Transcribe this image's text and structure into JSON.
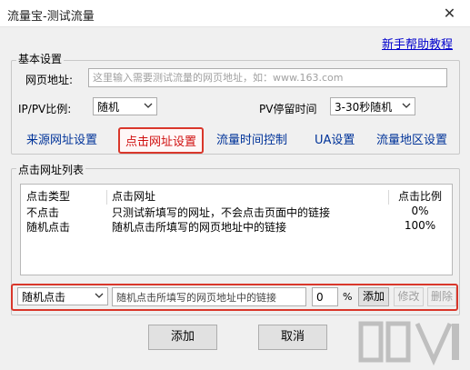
{
  "window": {
    "title": "流量宝-测试流量",
    "close_glyph": "✕"
  },
  "help_link": "新手帮助教程",
  "basic": {
    "group_label": "基本设置",
    "url_label": "网页地址:",
    "url_placeholder": "这里输入需要测试流量的网页地址，如：www.163.com",
    "ippv_label": "IP/PV比例:",
    "ippv_value": "随机",
    "stay_label": "PV停留时间",
    "stay_value": "3-30秒随机",
    "tabs": [
      "来源网址设置",
      "点击网址设置",
      "流量时间控制",
      "UA设置",
      "流量地区设置"
    ]
  },
  "click_list": {
    "group_label": "点击网址列表",
    "headers": [
      "点击类型",
      "点击网址",
      "点击比例"
    ],
    "rows": [
      {
        "type": "不点击",
        "url": "只测试新填写的网址，不会点击页面中的链接",
        "ratio": "0%"
      },
      {
        "type": "随机点击",
        "url": "随机点击所填写的网页地址中的链接",
        "ratio": "100%"
      }
    ]
  },
  "editor": {
    "type_value": "随机点击",
    "url_value": "随机点击所填写的网页地址中的链接",
    "ratio_value": "0",
    "percent_sign": "%",
    "add_label": "添加",
    "edit_label": "修改",
    "delete_label": "删除"
  },
  "footer": {
    "ok_label": "添加",
    "cancel_label": "取消"
  },
  "colors": {
    "highlight": "#d9372b",
    "link": "#003399"
  },
  "icons": {
    "dropdown": "chevron-down-icon",
    "close": "close-icon"
  }
}
